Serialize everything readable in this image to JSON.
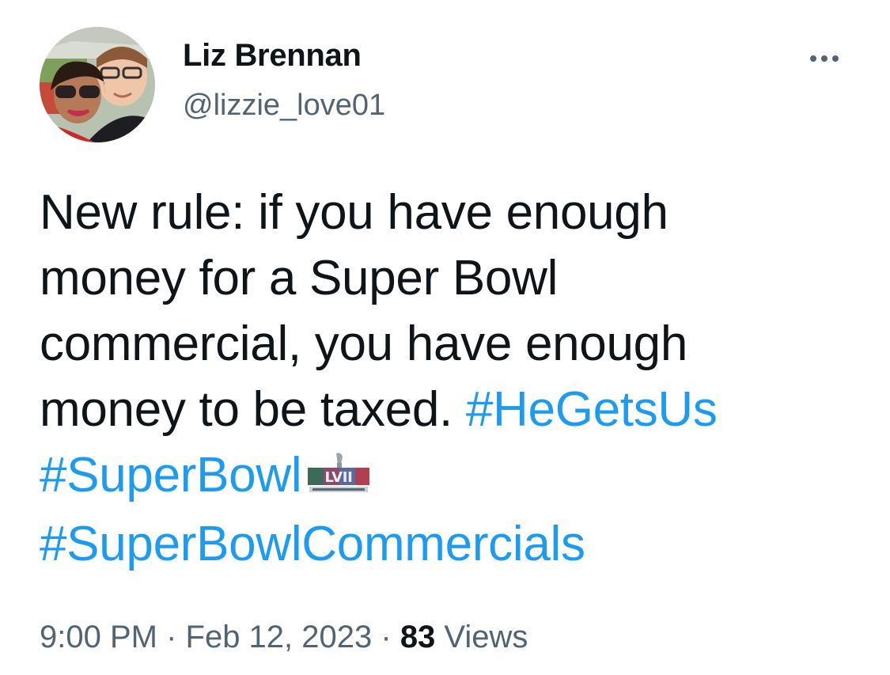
{
  "author": {
    "name": "Liz Brennan",
    "handle": "@lizzie_love01"
  },
  "tweet": {
    "line1": "New rule: if you have enough",
    "line2": "money for a Super Bowl",
    "line3": "commercial, you have enough",
    "line4_text": "money to be taxed. ",
    "hashtags": {
      "hegetsus": "#HeGetsUs",
      "superbowl": "#SuperBowl",
      "superbowlcommercials": "#SuperBowlCommercials"
    },
    "logo_icon": "super-bowl-lvii-logo-icon"
  },
  "meta": {
    "time": "9:00 PM",
    "separator": " · ",
    "date": "Feb 12, 2023",
    "views_count": "83",
    "views_label": " Views"
  },
  "icons": {
    "more": "more-options-icon"
  },
  "colors": {
    "text": "#0f1419",
    "secondary": "#536471",
    "link": "#1d9bf0"
  }
}
